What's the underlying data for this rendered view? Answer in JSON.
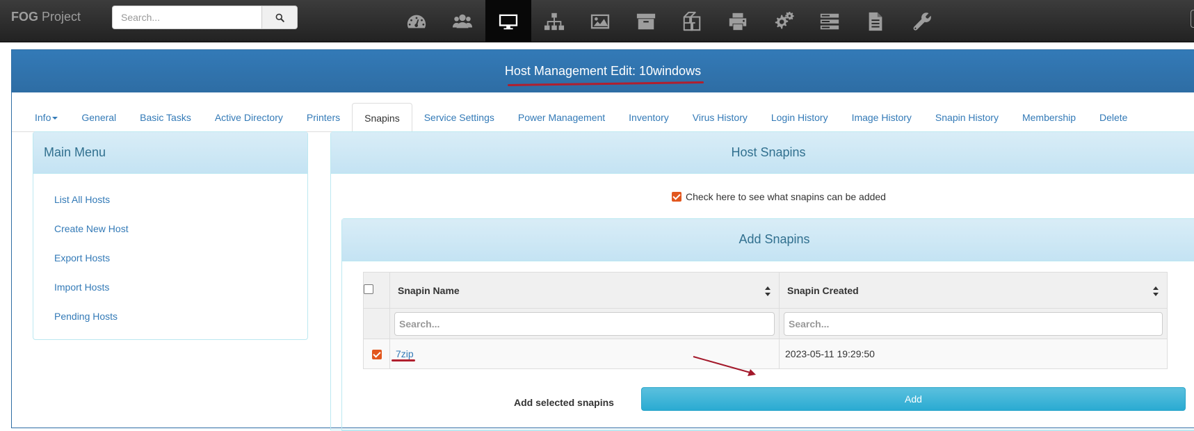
{
  "navbar": {
    "brand_bold": "FOG",
    "brand_rest": " Project",
    "search_placeholder": "Search...",
    "icons": [
      "dashboard-icon",
      "users-icon",
      "desktop-icon",
      "sitemap-icon",
      "image-icon",
      "archive-icon",
      "copy-icon",
      "printer-icon",
      "cogs-icon",
      "server-icon",
      "file-icon",
      "wrench-icon"
    ],
    "active_icon": "desktop-icon"
  },
  "header": {
    "title": "Host Management Edit: 10windows"
  },
  "tabs": [
    {
      "label": "Info"
    },
    {
      "label": "General"
    },
    {
      "label": "Basic Tasks"
    },
    {
      "label": "Active Directory"
    },
    {
      "label": "Printers"
    },
    {
      "label": "Snapins"
    },
    {
      "label": "Service Settings"
    },
    {
      "label": "Power Management"
    },
    {
      "label": "Inventory"
    },
    {
      "label": "Virus History"
    },
    {
      "label": "Login History"
    },
    {
      "label": "Image History"
    },
    {
      "label": "Snapin History"
    },
    {
      "label": "Membership"
    },
    {
      "label": "Delete"
    }
  ],
  "active_tab": "Snapins",
  "sidebar": {
    "title": "Main Menu",
    "items": [
      {
        "label": "List All Hosts"
      },
      {
        "label": "Create New Host"
      },
      {
        "label": "Export Hosts"
      },
      {
        "label": "Import Hosts"
      },
      {
        "label": "Pending Hosts"
      }
    ]
  },
  "host_snapins": {
    "title": "Host Snapins",
    "check_label": "Check here to see what snapins can be added",
    "check_checked": true
  },
  "add_snapins": {
    "title": "Add Snapins",
    "columns": [
      "Snapin Name",
      "Snapin Created"
    ],
    "filter_placeholder": "Search...",
    "rows": [
      {
        "name": "7zip",
        "created": "2023-05-11 19:29:50",
        "checked": true
      }
    ],
    "add_label": "Add selected snapins",
    "add_button": "Add"
  },
  "colors": {
    "accent": "#337ab7",
    "checkbox": "#e2571e",
    "annotation": "#b01f2e",
    "add_button": "#31b0d5"
  }
}
